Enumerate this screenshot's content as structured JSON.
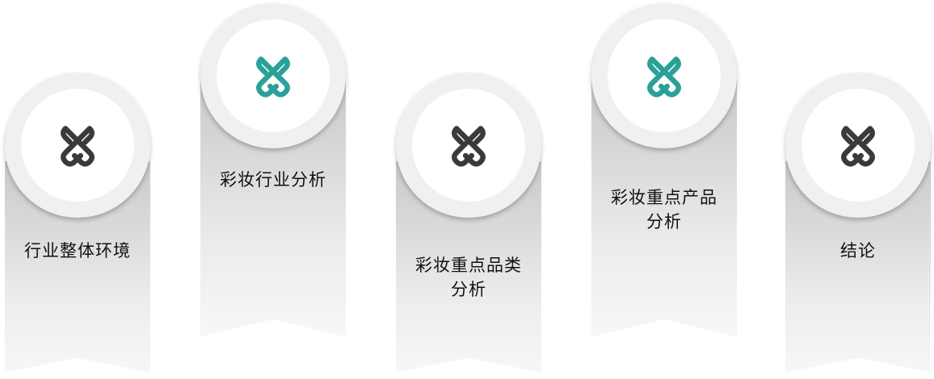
{
  "colors": {
    "teal": "#2aa198",
    "dark": "#3a3a3a"
  },
  "items": [
    {
      "label": "行业整体环境",
      "icon": "link-knot-icon",
      "icon_color": "#3a3a3a"
    },
    {
      "label": "彩妆行业分析",
      "icon": "link-knot-icon",
      "icon_color": "#2aa198"
    },
    {
      "label": "彩妆重点品类\n分析",
      "icon": "link-knot-icon",
      "icon_color": "#3a3a3a"
    },
    {
      "label": "彩妆重点产品\n分析",
      "icon": "link-knot-icon",
      "icon_color": "#2aa198"
    },
    {
      "label": "结论",
      "icon": "link-knot-icon",
      "icon_color": "#3a3a3a"
    }
  ]
}
